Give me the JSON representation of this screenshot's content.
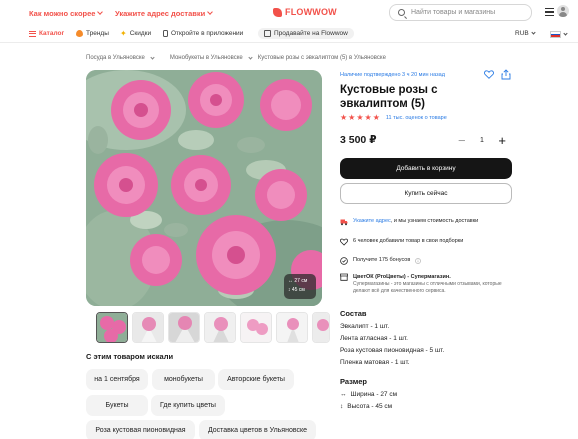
{
  "header": {
    "delivery_city": "Как можно скорее",
    "delivery_address": "Укажите адрес доставки",
    "logo": "FLOWWOW",
    "search_placeholder": "Найти товары и магазины"
  },
  "nav": {
    "items": [
      "Каталог",
      "Тренды",
      "Скидки",
      "Откройте в приложении",
      "Продавайте на Flowwow"
    ],
    "currency": "RUB"
  },
  "breadcrumbs": [
    "Посуда в Ульяновске",
    "Монобукеты в Ульяновске",
    "Кустовые розы с эвкалиптом (5) в Ульяновске"
  ],
  "gallery": {
    "size_width": "27 см",
    "size_height": "45 см"
  },
  "product": {
    "availability": "Наличие подтверждено 3 ч 20 мин назад",
    "title": "Кустовые розы с эвкалиптом (5)",
    "rating_stars": 5,
    "rating_text": "11 тыс. оценок о товаре",
    "price": "3 500 ₽",
    "quantity": "1",
    "add_to_cart": "Добавить в корзину",
    "buy_now": "Купить сейчас"
  },
  "info": {
    "delivery_link": "Укажите адрес",
    "delivery_rest": ", и мы узнаем стоимость доставки",
    "added_to_selection": "6 человек добавили товар в свои подборки",
    "bonuses": "Получите 175 бонусов",
    "shop_name": "ЦветОК (ProЦветы) - Супермагазин.",
    "shop_desc": "Супермагазины - это магазины с отличными отзывами, которые делают всё для качественного сервиса."
  },
  "composition": {
    "title": "Состав",
    "items": [
      "Эвкалипт - 1 шт.",
      "Лента атласная - 1 шт.",
      "Роза кустовая пионовидная - 5 шт.",
      "Пленка матовая - 1 шт."
    ]
  },
  "size": {
    "title": "Размер",
    "width": "Ширина - 27 см",
    "height": "Высота - 45 см"
  },
  "searched": {
    "title": "С этим товаром искали",
    "chips": [
      "на 1 сентября",
      "монобукеты",
      "Авторские букеты",
      "Букеты",
      "Где купить цветы",
      "Роза кустовая пионовидная",
      "Доставка цветов в Ульяновске"
    ]
  },
  "colors": {
    "brand": "#f2514a",
    "link": "#2a7be4",
    "dark_button": "#151515"
  }
}
